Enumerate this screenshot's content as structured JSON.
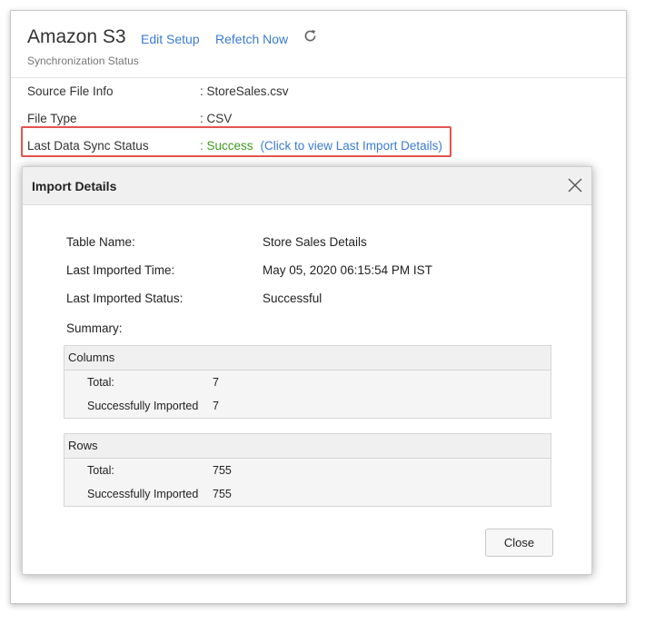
{
  "header": {
    "title": "Amazon S3",
    "edit_setup": "Edit Setup",
    "refetch_now": "Refetch Now",
    "subtitle": "Synchronization Status"
  },
  "info": [
    {
      "label": "Source File Info",
      "value": ": StoreSales.csv"
    },
    {
      "label": "File Type",
      "value": ": CSV"
    },
    {
      "label": "Last Data Sync Status",
      "value": ": Success",
      "link": "(Click to view Last Import Details)"
    }
  ],
  "dialog": {
    "title": "Import Details",
    "rows": [
      {
        "label": "Table Name:",
        "value": "Store Sales Details"
      },
      {
        "label": "Last Imported Time:",
        "value": "May 05, 2020 06:15:54 PM IST"
      },
      {
        "label": "Last Imported Status:",
        "value": "Successful"
      }
    ],
    "summary_label": "Summary:",
    "columns": {
      "heading": "Columns",
      "total_label": "Total:",
      "total_value": "7",
      "success_label": "Successfully Imported",
      "success_value": "7"
    },
    "rows_box": {
      "heading": "Rows",
      "total_label": "Total:",
      "total_value": "755",
      "success_label": "Successfully Imported",
      "success_value": "755"
    },
    "close_label": "Close"
  },
  "colors": {
    "link": "#3a7bd5",
    "success": "#3e9a1c",
    "highlight": "#e3534e"
  },
  "icons": {
    "refresh": "refresh-icon",
    "close": "close-icon"
  }
}
